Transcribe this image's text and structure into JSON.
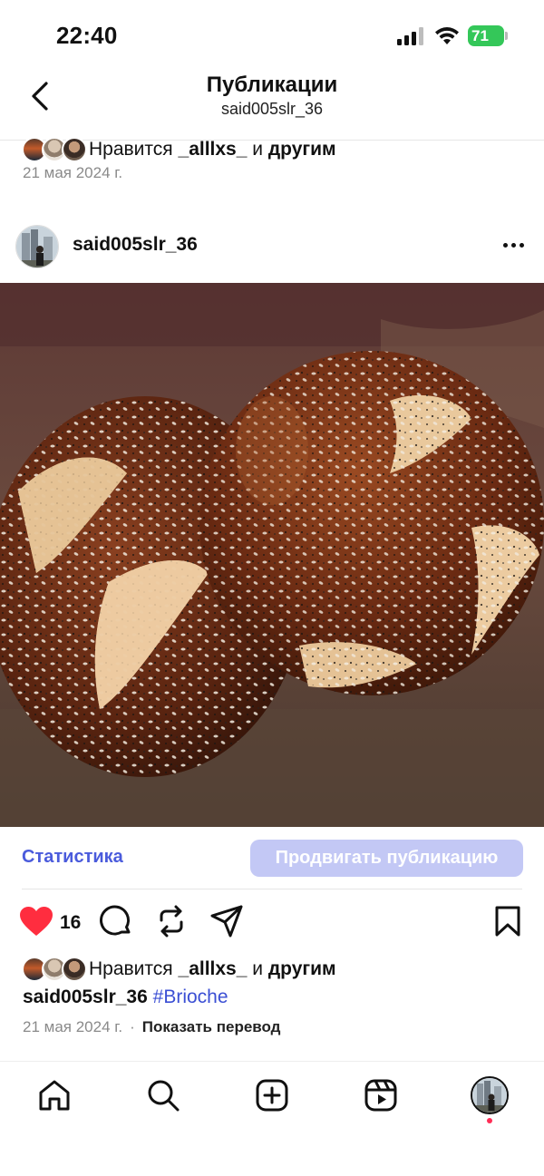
{
  "status_bar": {
    "time": "22:40",
    "battery": "71"
  },
  "header": {
    "title": "Публикации",
    "subtitle": "said005slr_36"
  },
  "previous_post": {
    "likes_prefix": "Нравится",
    "likes_user": "_alllxs_",
    "likes_and": "и",
    "likes_others": "другим",
    "date": "21 мая 2024 г."
  },
  "post": {
    "username": "said005slr_36",
    "photo_icon": "brioche-photo",
    "stats_label": "Статистика",
    "promote_label": "Продвигать публикацию",
    "like_count": "16",
    "liked": true,
    "likes_prefix": "Нравится",
    "likes_user": "_alllxs_",
    "likes_and": "и",
    "likes_others": "другим",
    "caption_user": "said005slr_36",
    "caption_hashtag": "#Brioche",
    "date": "21 мая 2024 г.",
    "separator": "·",
    "translate_label": "Показать перевод"
  },
  "colors": {
    "accent": "#4a5bdc",
    "promote_bg": "#c3c8f5",
    "like_red": "#ff2d3f",
    "battery_green": "#34c759",
    "notification_dot": "#ff2d55"
  },
  "tabbar": {
    "items": [
      "home-icon",
      "search-icon",
      "create-icon",
      "reels-icon",
      "profile-avatar"
    ]
  }
}
